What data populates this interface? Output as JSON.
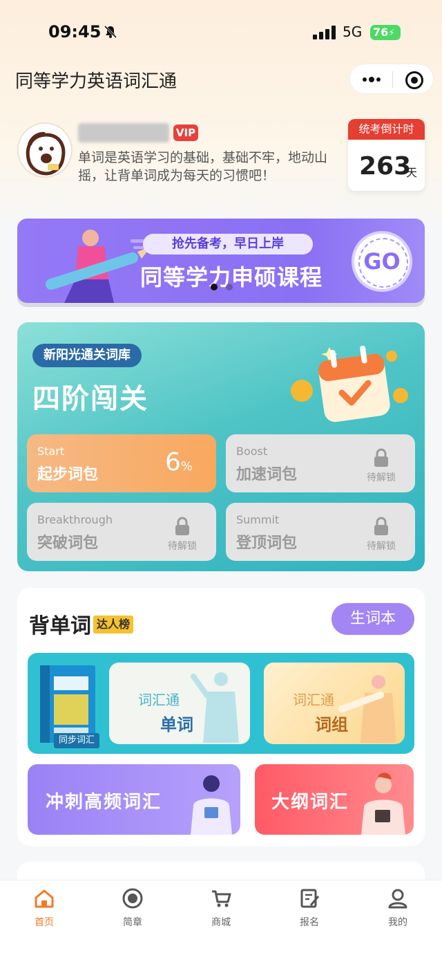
{
  "status_bar": {
    "time": "09:45",
    "network": "5G",
    "battery": "76"
  },
  "nav": {
    "title": "同等学力英语词汇通"
  },
  "profile": {
    "vip_label": "VIP",
    "motto": "单词是英语学习的基础，基础不牢，地动山摇，让背单词成为每天的习惯吧！",
    "countdown": {
      "label": "统考倒计时",
      "days": "263",
      "unit": "天"
    }
  },
  "banner": {
    "tagline": "抢先备考，早日上岸",
    "headline": "同等学力申硕课程",
    "go_label": "GO"
  },
  "levels": {
    "library_label": "新阳光通关词库",
    "title": "四阶闯关",
    "cards": [
      {
        "en": "Start",
        "cn": "起步词包",
        "progress": "6",
        "progress_unit": "%"
      },
      {
        "en": "Boost",
        "cn": "加速词包",
        "status": "待解锁"
      },
      {
        "en": "Breakthrough",
        "cn": "突破词包",
        "status": "待解锁"
      },
      {
        "en": "Summit",
        "cn": "登顶词包",
        "status": "待解锁"
      }
    ]
  },
  "words": {
    "heading": "背单词",
    "rank_badge": "达人榜",
    "new_words_button": "生词本",
    "sync_label": "同步词汇",
    "vocab_word": {
      "prefix": "词汇通",
      "label": "单词"
    },
    "vocab_phrase": {
      "prefix": "词汇通",
      "label": "词组"
    },
    "sprint": "冲刺高频词汇",
    "outline": "大纲词汇"
  },
  "tabs": [
    {
      "label": "首页",
      "icon": "home-icon",
      "active": true
    },
    {
      "label": "简章",
      "icon": "record-icon"
    },
    {
      "label": "商城",
      "icon": "cart-icon"
    },
    {
      "label": "报名",
      "icon": "edit-icon"
    },
    {
      "label": "我的",
      "icon": "user-icon"
    }
  ],
  "colors": {
    "accent": "#f07b26",
    "vip": "#e8413b",
    "countdown": "#e53e32",
    "levels_bg": "#2fb3bf",
    "purple": "#9479f6"
  }
}
